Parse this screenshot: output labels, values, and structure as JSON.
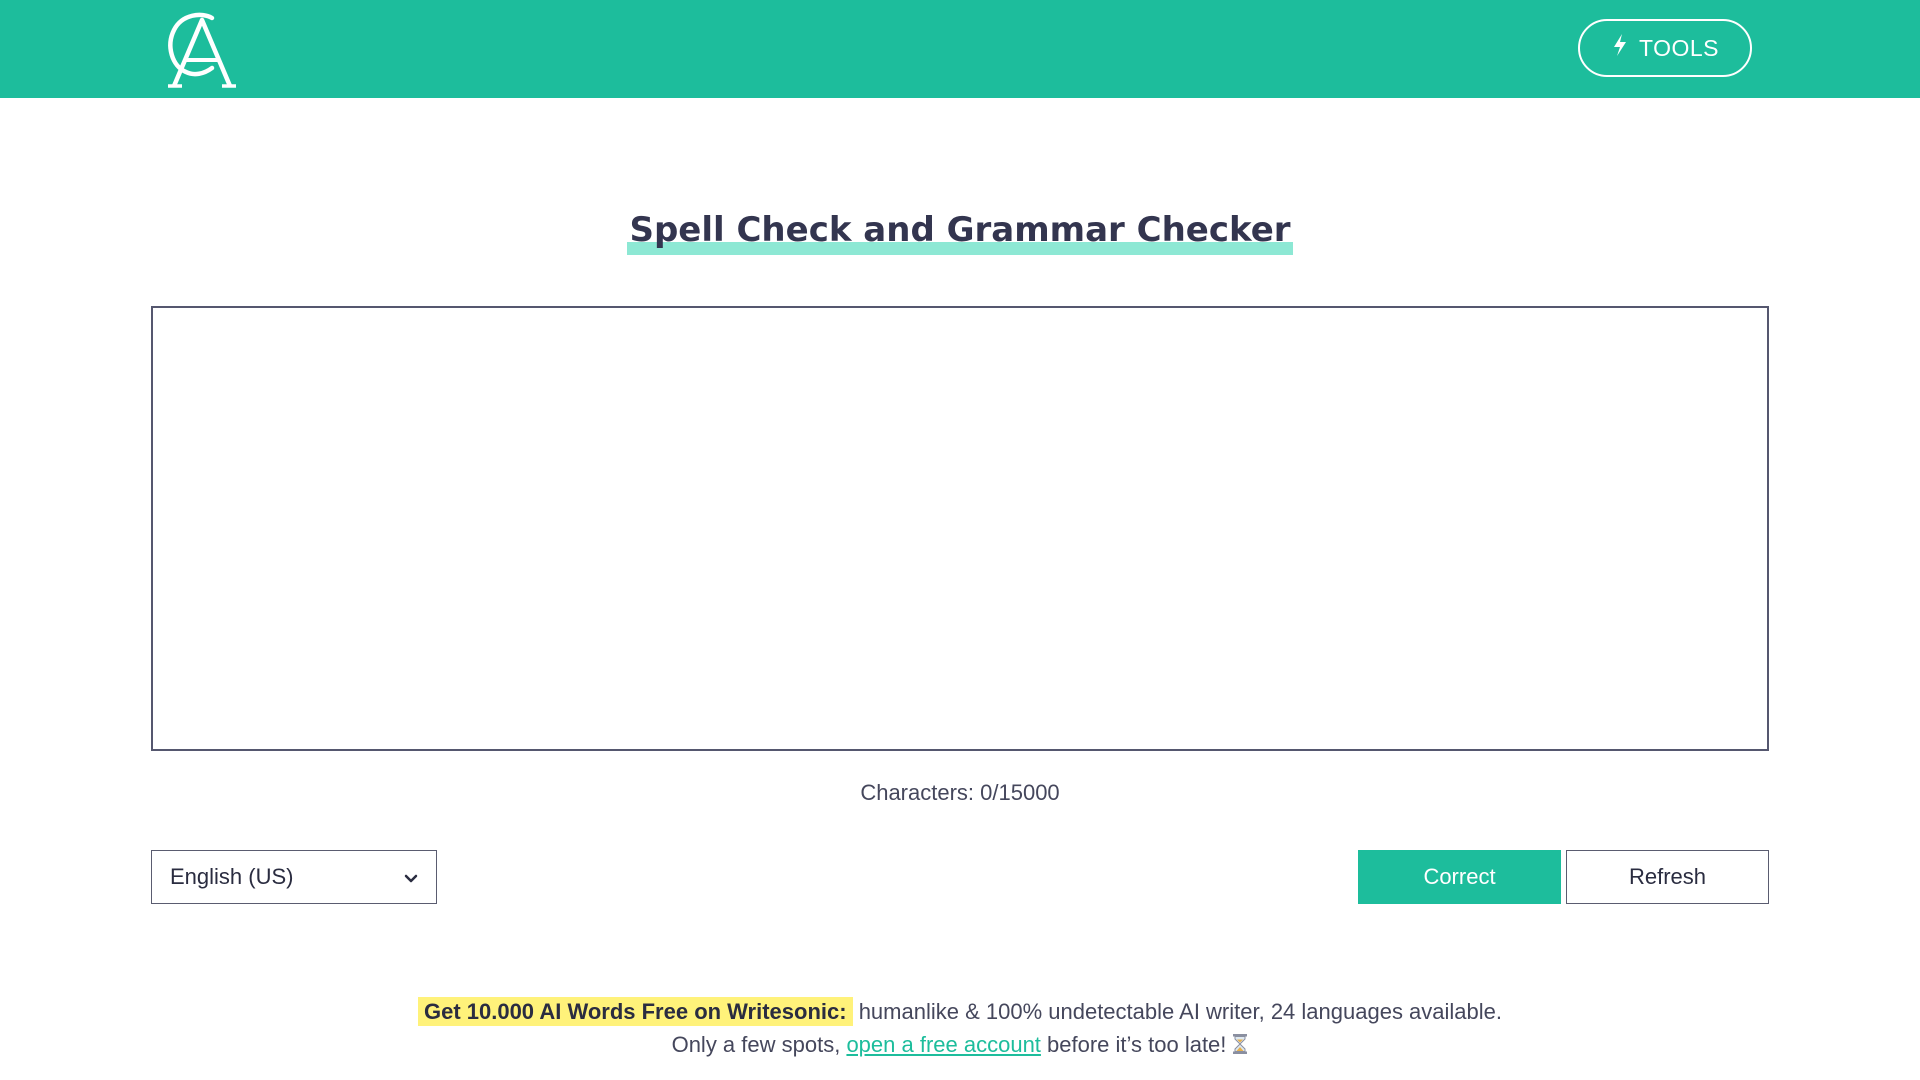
{
  "colors": {
    "brand": "#1dbd9c",
    "title_underline": "#8de8d4",
    "promo_highlight": "#fff27a",
    "text": "#33354f"
  },
  "header": {
    "logo_icon": "ca-monogram-logo",
    "tools_button": {
      "icon": "lightning-bolt-icon",
      "label": "TOOLS"
    }
  },
  "main": {
    "title": "Spell Check and Grammar Checker",
    "editor": {
      "value": "",
      "placeholder": ""
    },
    "char_count": "Characters: 0/15000",
    "language_select": {
      "selected": "English (US)",
      "icon": "chevron-down-icon"
    },
    "correct_label": "Correct",
    "refresh_label": "Refresh"
  },
  "promo": {
    "highlight": "Get 10.000 AI Words Free on Writesonic:",
    "line1_rest": " humanlike & 100% undetectable AI writer, 24 languages available.",
    "line2_before": "Only a few spots, ",
    "link": "open a free account",
    "line2_after": " before it’s too late!",
    "icon": "hourglass-icon"
  }
}
